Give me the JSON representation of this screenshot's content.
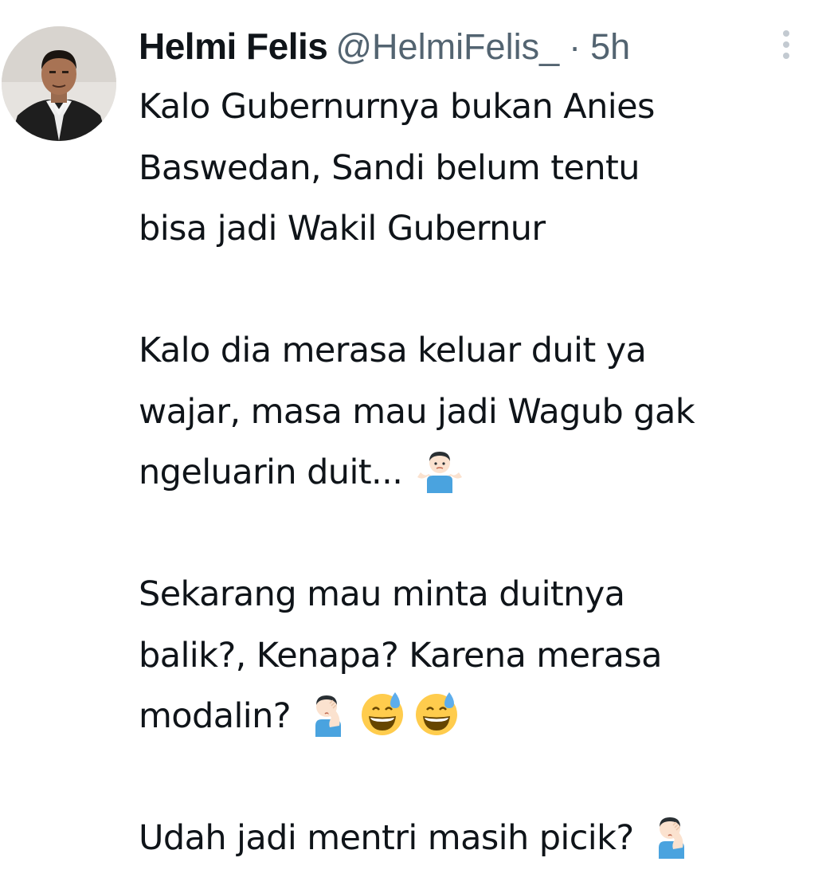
{
  "author": {
    "name": "Helmi Felis",
    "handle": "@HelmiFelis_",
    "separator": "·",
    "time": "5h"
  },
  "icons": {
    "more": "more-vertical-icon",
    "shrug": "person-shrugging-emoji",
    "facepalm": "person-facepalming-emoji",
    "grin_sweat": "grinning-face-with-sweat-emoji"
  },
  "tweet": {
    "p1": {
      "l1": "Kalo Gubernurnya bukan Anies",
      "l2": "Baswedan, Sandi belum tentu",
      "l3": "bisa jadi Wakil Gubernur"
    },
    "p2": {
      "l1": "Kalo dia merasa keluar duit ya",
      "l2": "wajar, masa mau jadi Wagub gak",
      "l3": "ngeluarin duit..."
    },
    "p3": {
      "l1": "Sekarang mau minta duitnya",
      "l2": "balik?, Kenapa? Karena merasa",
      "l3": "modalin?"
    },
    "p4": {
      "l1": "Udah jadi mentri masih picik?"
    }
  },
  "colors": {
    "text": "#0f1419",
    "secondary": "#536471",
    "background": "#ffffff"
  }
}
